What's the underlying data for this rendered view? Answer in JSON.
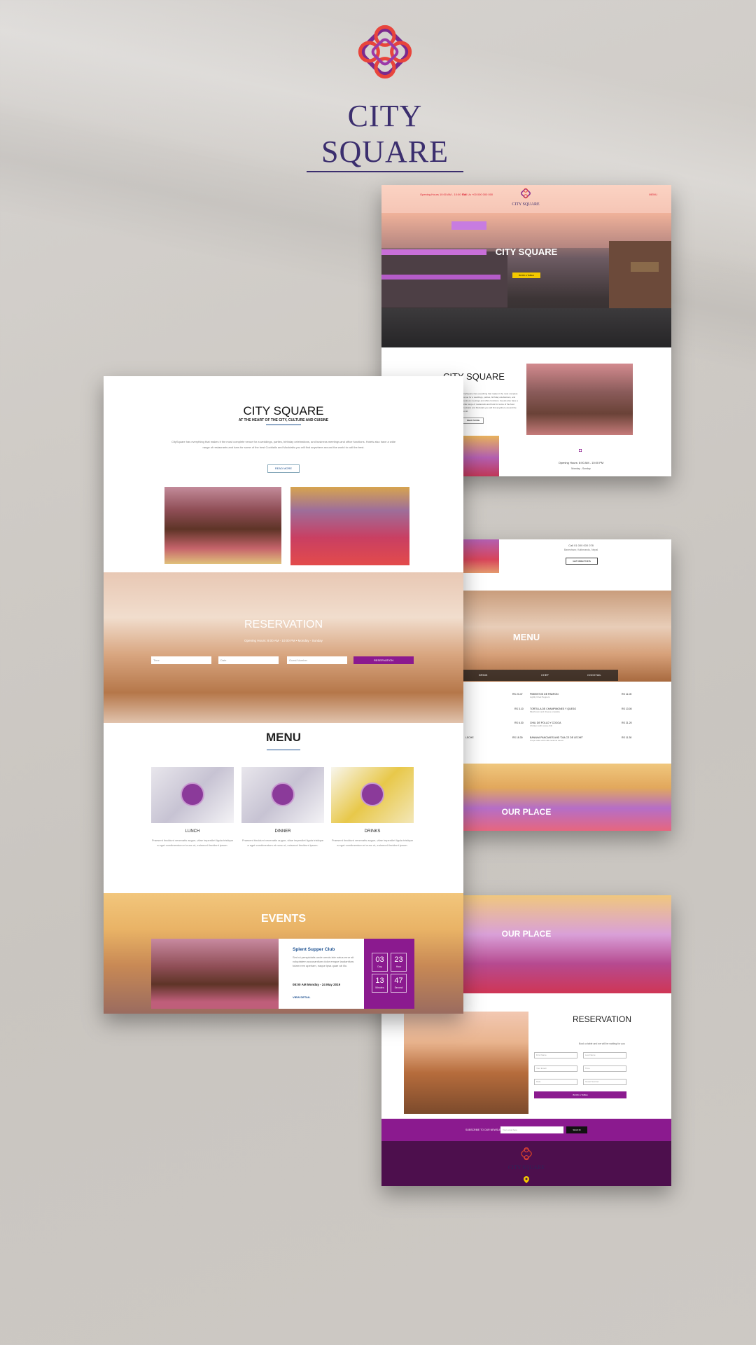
{
  "logo": {
    "brand": "CITY SQUARE"
  },
  "colors": {
    "purple": "#8b1a8f",
    "dark_purple": "#4d0f4d",
    "navy": "#3b2e6e",
    "accent_blue": "#1b4f8f",
    "yellow": "#f3c800"
  },
  "right_top": {
    "nav_left_1": "Opening Hours 10:00 AM - 10:00 PM",
    "nav_left_2": "Call Us +00 000 000 000",
    "nav_logo": "CITY SQUARE",
    "nav_right": "MENU",
    "hero_title": "CITY SQUARE",
    "hero_button": "BOOK A TABLE",
    "about_title": "CITY SQUARE",
    "about_text": "CitySquare has everything that makes it the most complete venue for a weddings, parties, birthday celebrations, and business meetings and office functions. Guests also have a wide range of restaurants and bars for some of the best Cocktails and Mocktails you will find anywhere around the world.",
    "read_more": "READ MORE",
    "hours": "Opening Hours: 8:00 AM - 10:00 PM",
    "days": "Monday - Sunday"
  },
  "right_middle": {
    "call": "Call 01 000 000 078",
    "address": "Baneshwor, Kathmandu, Nepal",
    "directions": "GET DIRECTIONS",
    "menu_title": "MENU",
    "tabs": [
      "DRINK",
      "CHEF",
      "COCKTAIL"
    ],
    "items_left": [
      {
        "price": "RS 23.47"
      },
      {
        "price": "RS 3.10"
      },
      {
        "price": "RS 6.30"
      },
      {
        "name": "LECHE",
        "price": "RS 18.30"
      }
    ],
    "items_right": [
      {
        "name": "PIMIENTOS DE PADRON",
        "desc": "Lightly Fried Peppers",
        "price": "RS 11.00"
      },
      {
        "name": "TORTILLA DE CHAMPINONES Y QUESO",
        "desc": "Mushroom and cheese omelette",
        "price": "RS 13.00"
      },
      {
        "name": "CHILI DE POLLO Y COCOA",
        "desc": "Chicken with cocoa chili",
        "price": "RS 21.20"
      },
      {
        "name": "BANANA PANCAKES AND \"DULCE DE LECHE\"",
        "desc": "Crepe cake with milk caramel sauce",
        "price": "RS 11.30"
      }
    ],
    "place_title": "OUR PLACE"
  },
  "right_bottom": {
    "place_title": "OUR PLACE",
    "reservation_title": "RESERVATION",
    "reservation_text": "Book a table and we will be waiting for you",
    "fields": [
      "First Name",
      "Last Name",
      "Your Email",
      "Time",
      "Date",
      "Guest Number"
    ],
    "book_button": "BOOK A TABLE",
    "newsletter_label": "SUBSCRIBE TO OUR NEWSLETTER",
    "newsletter_placeholder": "Your email here",
    "newsletter_button": "SIGN IN",
    "footer_logo": "CITY SQUARE"
  },
  "left": {
    "about_title": "CITY SQUARE",
    "about_sub": "AT THE HEART OF THE CITY, CULTURE AND CUISINE",
    "about_text": "CitySquare has everything that makes it the most complete venue for a weddings, parties, birthday celebrations, and business meetings and office functions. Hotels also have a wide range of restaurants and bars for some of the best Cocktails and Mocktails you will find anywhere around the world to call the best.",
    "read_more": "READ MORE",
    "reservation_title": "RESERVATION",
    "reservation_sub": "Opening Hours: 8:00 AM - 10:00 PM  •  Monday - Sunday",
    "inputs": [
      "Time",
      "Date",
      "Guest Number"
    ],
    "reservation_button": "RESERVATION",
    "menu_title": "MENU",
    "menu_items": [
      {
        "name": "LUNCH",
        "desc": "Praesent tincidunt venenatis augue, vitae imperdiet ligula tristique a eget condimentum et nunc ut, euismod tincidunt ipsum."
      },
      {
        "name": "DINNER",
        "desc": "Praesent tincidunt venenatis augue, vitae imperdiet ligula tristique a eget condimentum et nunc ut, euismod tincidunt ipsum."
      },
      {
        "name": "DRINKS",
        "desc": "Praesent tincidunt venenatis augue, vitae imperdiet ligula tristique a eget condimentum et nunc ut, euismod tincidunt ipsum."
      }
    ],
    "events_title": "EVENTS",
    "event_name": "Splent Supper Club",
    "event_text": "Sed ut perspiciatis unde omnis iste natus error sit voluptatem accusantium dolor emque laudantium, totam rem aperiam, eaque ipsa quae ab illo.",
    "event_date": "08:00 AM Monday - 24 May 2019",
    "view_detail": "VIEW DETAIL",
    "countdown": [
      {
        "value": "03",
        "unit": "Day"
      },
      {
        "value": "23",
        "unit": "Hour"
      },
      {
        "value": "13",
        "unit": "Minutes"
      },
      {
        "value": "47",
        "unit": "Second"
      }
    ]
  }
}
